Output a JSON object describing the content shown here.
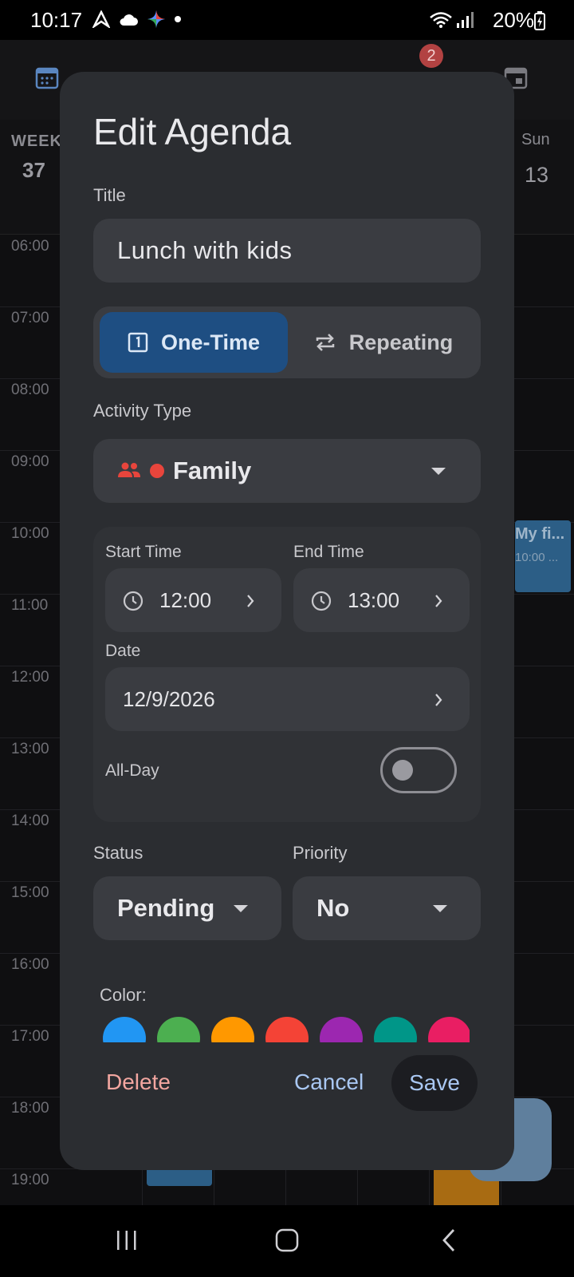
{
  "status_bar": {
    "time": "10:17",
    "battery": "20%"
  },
  "background": {
    "badge_count": "2",
    "week_label": "WEEK",
    "week_number": "37",
    "sun_label": "Sun",
    "sun_date": "13",
    "hours": [
      "06:00",
      "07:00",
      "08:00",
      "09:00",
      "10:00",
      "11:00",
      "12:00",
      "13:00",
      "14:00",
      "15:00",
      "16:00",
      "17:00",
      "18:00",
      "19:00"
    ],
    "event_title": "My fi...",
    "event_time": "10:00 ..."
  },
  "dialog": {
    "title": "Edit Agenda",
    "title_label": "Title",
    "title_value": "Lunch with kids",
    "mode_one_time": "One-Time",
    "mode_repeating": "Repeating",
    "activity_label": "Activity Type",
    "activity_value": "Family",
    "activity_color": "#e8453c",
    "start_label": "Start Time",
    "start_value": "12:00",
    "end_label": "End Time",
    "end_value": "13:00",
    "date_label": "Date",
    "date_value": "12/9/2026",
    "allday_label": "All-Day",
    "status_label": "Status",
    "status_value": "Pending",
    "priority_label": "Priority",
    "priority_value": "No",
    "color_label": "Color:",
    "colors": [
      "#2196f3",
      "#4caf50",
      "#ff9800",
      "#f44336",
      "#9c27b0",
      "#009688",
      "#e91e63"
    ],
    "delete_label": "Delete",
    "cancel_label": "Cancel",
    "save_label": "Save"
  }
}
